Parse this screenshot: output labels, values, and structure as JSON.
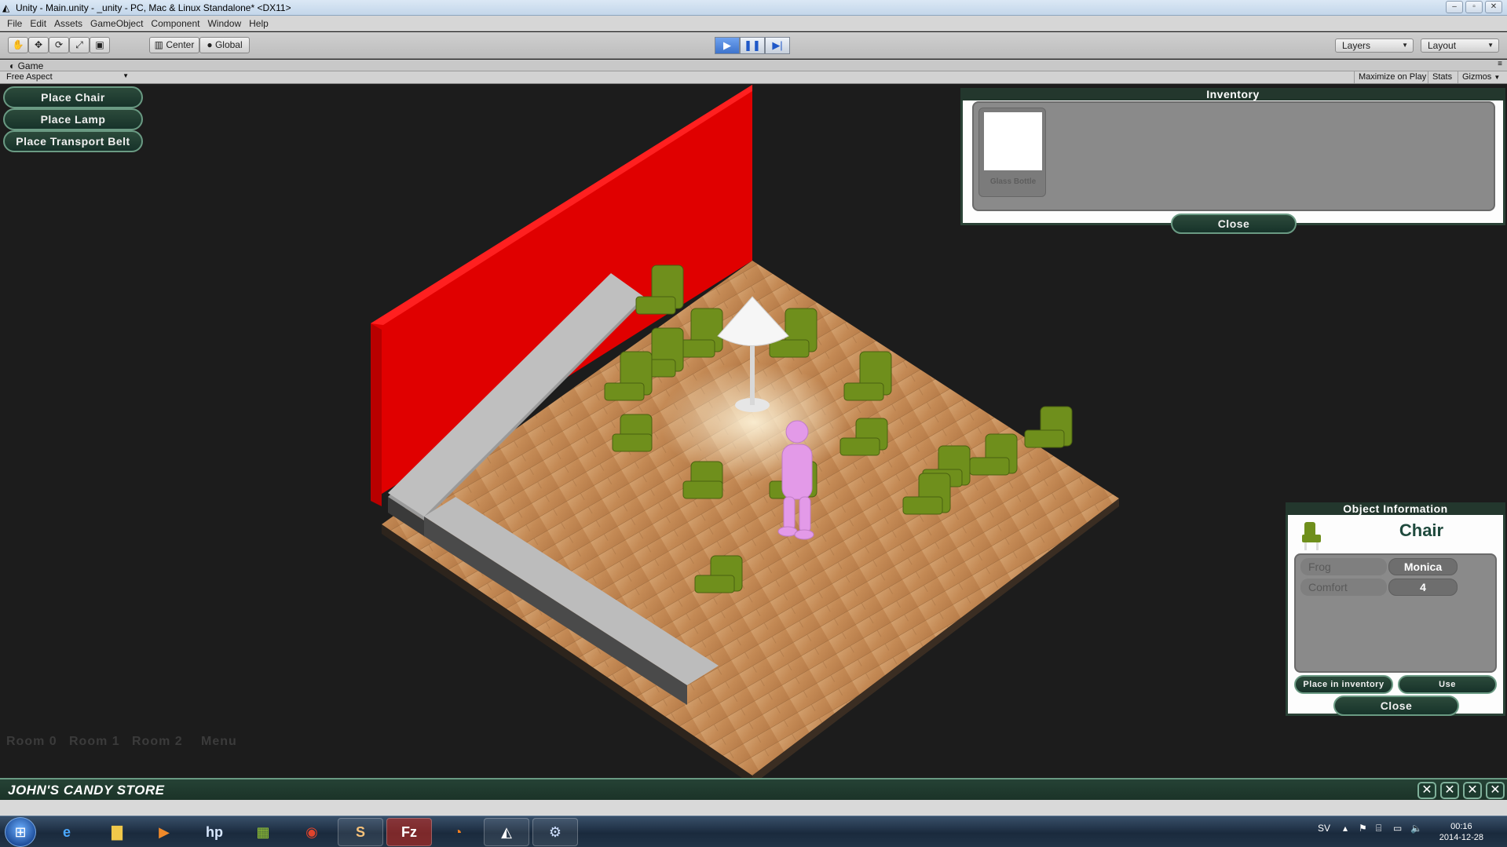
{
  "window": {
    "title": "Unity - Main.unity - _unity - PC, Mac & Linux Standalone* <DX11>"
  },
  "menu": [
    "File",
    "Edit",
    "Assets",
    "GameObject",
    "Component",
    "Window",
    "Help"
  ],
  "toolbar": {
    "pivot_center": "Center",
    "pivot_global": "Global",
    "layers": "Layers",
    "layout": "Layout"
  },
  "game_tab": {
    "label": "Game",
    "aspect": "Free Aspect",
    "maximize": "Maximize on Play",
    "stats": "Stats",
    "gizmos": "Gizmos"
  },
  "game": {
    "place_buttons": [
      "Place Chair",
      "Place Lamp",
      "Place Transport Belt"
    ],
    "inventory": {
      "title": "Inventory",
      "items": [
        {
          "name": "Glass Bottle"
        }
      ],
      "close": "Close"
    },
    "object_info": {
      "title": "Object Information",
      "object_name": "Chair",
      "properties": [
        {
          "label": "Frog",
          "value": "Monica"
        },
        {
          "label": "Comfort",
          "value": "4"
        }
      ],
      "place_in_inventory": "Place in inventory",
      "use": "Use",
      "close": "Close"
    },
    "rooms": [
      "Room 0",
      "Room 1",
      "Room 2",
      "Menu"
    ],
    "store_name": "JOHN'S CANDY STORE"
  },
  "taskbar": {
    "language": "SV",
    "time": "00:16",
    "date": "2014-12-28"
  },
  "colors": {
    "gui_green": "#23372d",
    "wall_red": "#e80000",
    "floor_wood": "#c8915b",
    "chair_green": "#6f8f1c",
    "character_pink": "#e39ae8"
  }
}
